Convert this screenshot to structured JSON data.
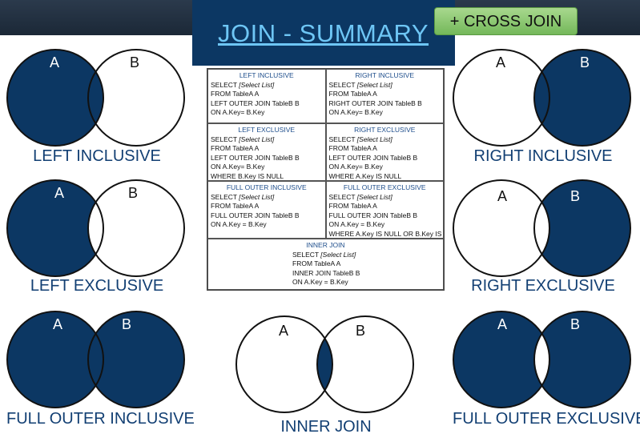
{
  "title": "JOIN - SUMMARY",
  "cross_join_label": "+ CROSS JOIN",
  "colors": {
    "fill": "#0c3763",
    "caption": "#123f73",
    "title": "#6ec6f5"
  },
  "diagrams": {
    "left_inclusive": {
      "caption": "LEFT INCLUSIVE",
      "a": "A",
      "b": "B"
    },
    "right_inclusive": {
      "caption": "RIGHT INCLUSIVE",
      "a": "A",
      "b": "B"
    },
    "left_exclusive": {
      "caption": "LEFT EXCLUSIVE",
      "a": "A",
      "b": "B"
    },
    "right_exclusive": {
      "caption": "RIGHT EXCLUSIVE",
      "a": "A",
      "b": "B"
    },
    "full_outer_inclusive": {
      "caption": "FULL OUTER INCLUSIVE",
      "a": "A",
      "b": "B"
    },
    "inner_join": {
      "caption": "INNER JOIN",
      "a": "A",
      "b": "B"
    },
    "full_outer_exclusive": {
      "caption": "FULL OUTER EXCLUSIVE",
      "a": "A",
      "b": "B"
    }
  },
  "sql": {
    "left_inclusive": {
      "heading": "LEFT INCLUSIVE",
      "select": "SELECT",
      "select_list": "[Select List]",
      "lines": [
        "FROM TableA A",
        "LEFT OUTER JOIN TableB B",
        "ON A.Key= B.Key"
      ]
    },
    "right_inclusive": {
      "heading": "RIGHT INCLUSIVE",
      "select": "SELECT",
      "select_list": "[Select List]",
      "lines": [
        "FROM TableA A",
        "RIGHT OUTER JOIN TableB B",
        "ON A.Key= B.Key"
      ]
    },
    "left_exclusive": {
      "heading": "LEFT EXCLUSIVE",
      "select": "SELECT",
      "select_list": "[Select List]",
      "lines": [
        "FROM TableA A",
        "LEFT OUTER JOIN TableB B",
        "ON A.Key= B.Key",
        "WHERE B.Key IS NULL"
      ]
    },
    "right_exclusive": {
      "heading": "RIGHT EXCLUSIVE",
      "select": "SELECT",
      "select_list": "[Select List]",
      "lines": [
        "FROM TableA A",
        "LEFT OUTER JOIN TableB B",
        "ON A.Key= B.Key",
        "WHERE A.Key IS NULL"
      ]
    },
    "full_outer_inclusive": {
      "heading": "FULL OUTER INCLUSIVE",
      "select": "SELECT",
      "select_list": "[Select List]",
      "lines": [
        "FROM TableA A",
        "FULL OUTER JOIN TableB B",
        "ON A.Key = B.Key"
      ]
    },
    "full_outer_exclusive": {
      "heading": "FULL OUTER EXCLUSIVE",
      "select": "SELECT",
      "select_list": "[Select List]",
      "lines": [
        "FROM TableA A",
        "FULL OUTER JOIN TableB B",
        "ON A.Key = B.Key",
        "WHERE A.Key IS NULL OR B.Key IS NULL"
      ]
    },
    "inner_join": {
      "heading": "INNER JOIN",
      "select": "SELECT",
      "select_list": "[Select List]",
      "lines": [
        "FROM TableA A",
        "INNER JOIN TableB B",
        "ON A.Key = B.Key"
      ]
    }
  }
}
